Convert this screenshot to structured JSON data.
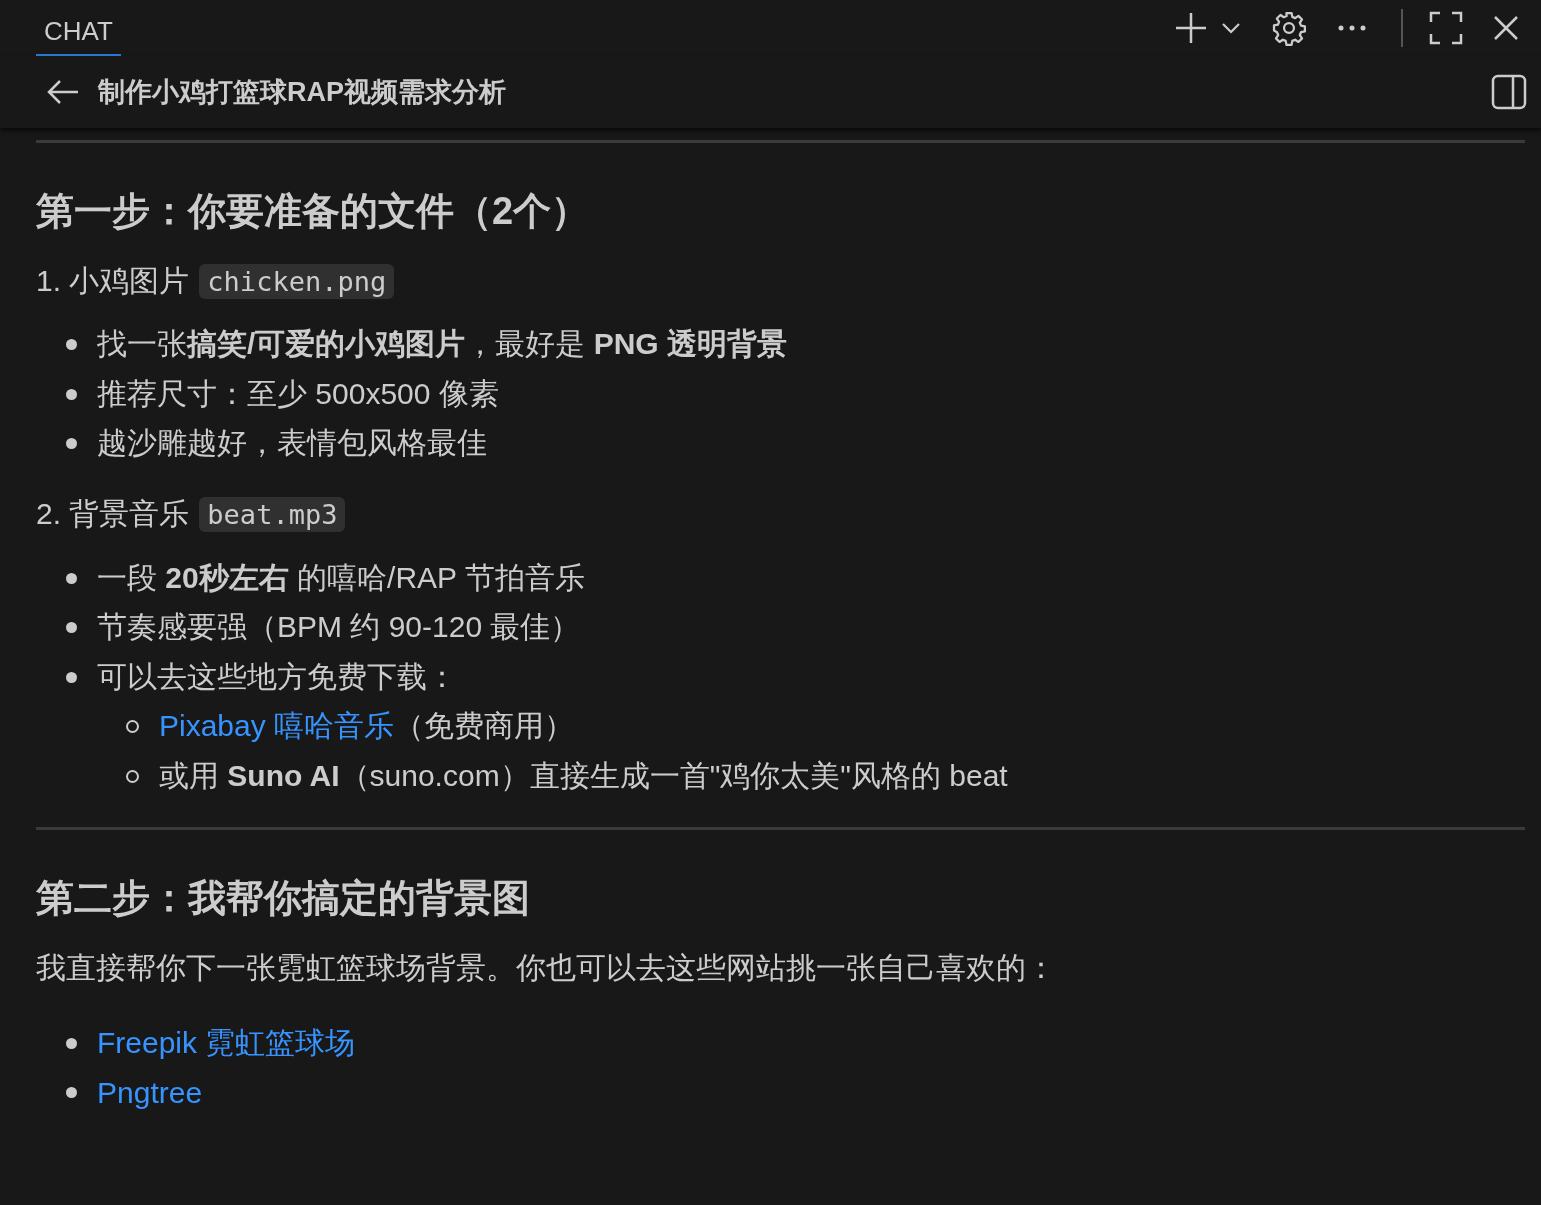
{
  "tab": {
    "label": "CHAT",
    "selected": true
  },
  "title": "制作小鸡打篮球RAP视频需求分析",
  "blocks": [
    {
      "kind": "rule"
    },
    {
      "kind": "heading",
      "text": "第一步：你要准备的文件（2个）"
    },
    {
      "kind": "numbered",
      "number": "1.",
      "label": "小鸡图片",
      "code": "chicken.png"
    },
    {
      "kind": "bullets",
      "items": [
        {
          "text": "找一张**搞笑/可爱的小鸡图片**，最好是 **PNG 透明背景**"
        },
        {
          "text": "推荐尺寸：至少 500x500 像素"
        },
        {
          "text": "越沙雕越好，表情包风格最佳"
        }
      ]
    },
    {
      "kind": "numbered",
      "number": "2.",
      "label": "背景音乐",
      "code": "beat.mp3"
    },
    {
      "kind": "bullets",
      "items": [
        {
          "text": "一段 **20秒左右** 的嘻哈/RAP 节拍音乐"
        },
        {
          "text": "节奏感要强（BPM 约 90-120 最佳）"
        },
        {
          "text": "可以去这些地方免费下载：",
          "children": [
            {
              "link": "Pixabay 嘻哈音乐",
              "text": "（免费商用）"
            },
            {
              "text": "或用 **Suno AI**（suno.com）直接生成一首\"鸡你太美\"风格的 beat"
            }
          ]
        }
      ]
    },
    {
      "kind": "rule"
    },
    {
      "kind": "heading",
      "text": "第二步：我帮你搞定的背景图"
    },
    {
      "kind": "paragraph",
      "text": "我直接帮你下一张霓虹篮球场背景。你也可以去这些网站挑一张自己喜欢的："
    },
    {
      "kind": "bullets",
      "items": [
        {
          "link": "Freepik 霓虹篮球场"
        },
        {
          "link": "Pngtree"
        }
      ]
    }
  ]
}
